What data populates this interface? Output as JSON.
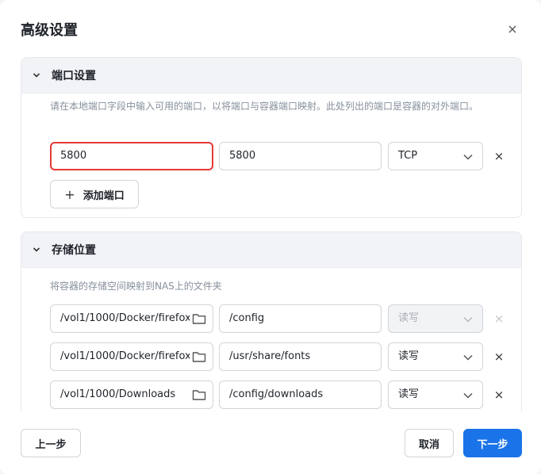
{
  "dialog": {
    "title": "高级设置",
    "close_label": "×"
  },
  "ports": {
    "header": "端口设置",
    "description": "请在本地端口字段中输入可用的端口，以将端口与容器端口映射。此处列出的端口是容器的对外端口。",
    "rows": [
      {
        "local": "5800",
        "container": "5800",
        "protocol": "TCP"
      }
    ],
    "add_label": "添加端口",
    "remove_label": "×"
  },
  "storage": {
    "header": "存储位置",
    "description": "将容器的存储空间映射到NAS上的文件夹",
    "rows": [
      {
        "host": "/vol1/1000/Docker/firefox",
        "container": "/config",
        "mode": "读写",
        "disabled": true
      },
      {
        "host": "/vol1/1000/Docker/firefox",
        "container": "/usr/share/fonts",
        "mode": "读写",
        "disabled": false
      },
      {
        "host": "/vol1/1000/Downloads",
        "container": "/config/downloads",
        "mode": "读写",
        "disabled": false
      }
    ],
    "remove_label": "×"
  },
  "footer": {
    "prev_label": "上一步",
    "cancel_label": "取消",
    "next_label": "下一步"
  },
  "colors": {
    "primary": "#1a73e8",
    "focus_border": "#e53935",
    "header_bg": "#f1f3f7"
  },
  "icons": [
    "close-icon",
    "chevron-down-icon",
    "plus-icon",
    "folder-icon",
    "select-arrow-icon"
  ]
}
